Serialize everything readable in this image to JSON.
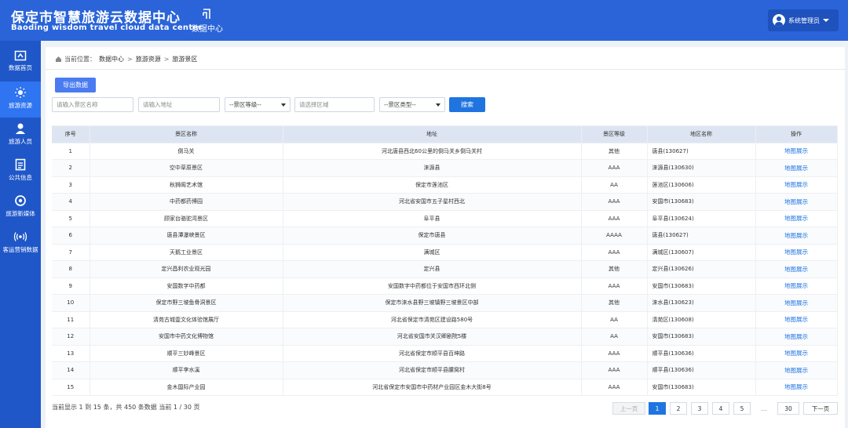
{
  "header": {
    "title_cn": "保定市智慧旅游云数据中心",
    "title_en": "Baoding wisdom travel cloud data center",
    "nav_item": "数据中心",
    "nav_icon": "data-center-icon",
    "user_name": "系统管理员"
  },
  "sidebar": {
    "items": [
      {
        "label": "数据首页",
        "icon": "home-icon"
      },
      {
        "label": "旅游资源",
        "icon": "sun-icon"
      },
      {
        "label": "旅游人员",
        "icon": "person-icon"
      },
      {
        "label": "公共信息",
        "icon": "document-icon"
      },
      {
        "label": "旅游新媒体",
        "icon": "media-icon"
      },
      {
        "label": "客运营销数据",
        "icon": "signal-icon"
      }
    ],
    "active_index": 1
  },
  "breadcrumb": {
    "prefix": "当前位置：",
    "items": [
      "数据中心",
      "旅游资源",
      "旅游景区"
    ]
  },
  "toolbar": {
    "export_label": "导出数据",
    "name_placeholder": "请输入景区名称",
    "address_placeholder": "请输入地址",
    "level_select": "--景区等级--",
    "region_placeholder": "请选择区域",
    "type_select": "--景区类型--",
    "search_label": "搜索"
  },
  "table": {
    "columns": [
      "序号",
      "景区名称",
      "地址",
      "景区等级",
      "地区名称",
      "操作"
    ],
    "action_label": "地图展示",
    "rows": [
      {
        "no": "1",
        "name": "倒马关",
        "address": "河北唐县西北60公里的倒马关乡倒马关村",
        "level": "其他",
        "region": "唐县(130627)"
      },
      {
        "no": "2",
        "name": "空中草原景区",
        "address": "涞源县",
        "level": "AAA",
        "region": "涞源县(130630)"
      },
      {
        "no": "3",
        "name": "秋狮阁艺术馆",
        "address": "保定市莲池区",
        "level": "AA",
        "region": "莲池区(130606)"
      },
      {
        "no": "4",
        "name": "中药都药博园",
        "address": "河北省安国市五子星村西北",
        "level": "AAA",
        "region": "安国市(130683)"
      },
      {
        "no": "5",
        "name": "顾家台骆驼湾景区",
        "address": "阜平县",
        "level": "AAA",
        "region": "阜平县(130624)"
      },
      {
        "no": "6",
        "name": "唐县潭瀑峡景区",
        "address": "保定市唐县",
        "level": "AAAA",
        "region": "唐县(130627)"
      },
      {
        "no": "7",
        "name": "天鹅工业景区",
        "address": "满城区",
        "level": "AAA",
        "region": "满城区(130607)"
      },
      {
        "no": "8",
        "name": "定兴昌利农业观光园",
        "address": "定兴县",
        "level": "其他",
        "region": "定兴县(130626)"
      },
      {
        "no": "9",
        "name": "安国数字中药都",
        "address": "安国数字中药都位于安国市西环北侧",
        "level": "AAA",
        "region": "安国市(130683)"
      },
      {
        "no": "10",
        "name": "保定市野三坡鱼骨洞景区",
        "address": "保定市涞水县野三坡镇野三坡景区中部",
        "level": "其他",
        "region": "涞水县(130623)"
      },
      {
        "no": "11",
        "name": "清苑古城壹文化体验馆展厅",
        "address": "河北省保定市清苑区建设路580号",
        "level": "AA",
        "region": "清苑区(130608)"
      },
      {
        "no": "12",
        "name": "安国市中药文化博物馆",
        "address": "河北省安国市关汉卿剧院5楼",
        "level": "AA",
        "region": "安国市(130683)"
      },
      {
        "no": "13",
        "name": "顺平三妙峰景区",
        "address": "河北省保定市顺平县百坤路",
        "level": "AAA",
        "region": "顺平县(130636)"
      },
      {
        "no": "14",
        "name": "顺平李水溪",
        "address": "河北省保定市顺平县腰窝村",
        "level": "AAA",
        "region": "顺平县(130636)"
      },
      {
        "no": "15",
        "name": "金木国际产业园",
        "address": "河北省保定市安国市中药材产业园区金木大街8号",
        "level": "AAA",
        "region": "安国市(130683)"
      }
    ]
  },
  "pagination": {
    "summary": "当前显示 1 到 15 条，共 450 条数据    当前 1 / 30 页",
    "prev": "上一页",
    "pages": [
      "1",
      "2",
      "3",
      "4",
      "5"
    ],
    "ellipsis": "...",
    "last": "30",
    "next": "下一页",
    "current": "1"
  }
}
